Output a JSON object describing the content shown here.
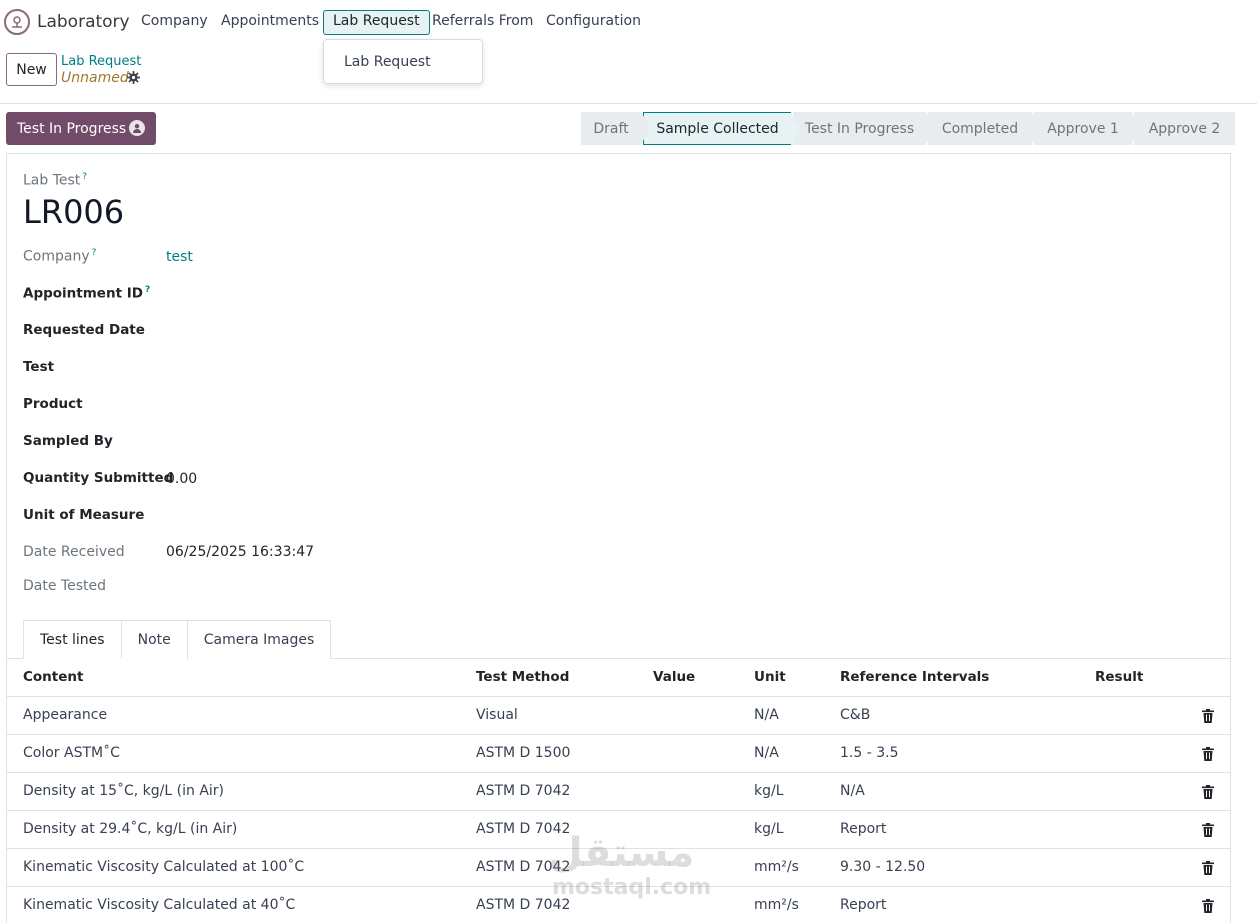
{
  "app": {
    "name": "Laboratory",
    "logo_icon": "microscope-icon"
  },
  "nav": {
    "items": [
      {
        "label": "Company"
      },
      {
        "label": "Appointments"
      },
      {
        "label": "Lab Request"
      },
      {
        "label": "Referrals From"
      },
      {
        "label": "Configuration"
      }
    ],
    "active_index": 2,
    "dropdown": {
      "items": [
        {
          "label": "Lab Request"
        }
      ]
    }
  },
  "control": {
    "new_label": "New",
    "breadcrumb": "Lab Request",
    "record_name": "Unnamed",
    "gear_icon": "gear-icon"
  },
  "status_button": {
    "label": "Test In Progress",
    "icon": "person-icon"
  },
  "statusbar": {
    "stages": [
      {
        "label": "Draft"
      },
      {
        "label": "Sample Collected"
      },
      {
        "label": "Test In Progress"
      },
      {
        "label": "Completed"
      },
      {
        "label": "Approve 1"
      },
      {
        "label": "Approve 2"
      }
    ],
    "current_index": 1
  },
  "form": {
    "lab_test_label": "Lab Test",
    "help_mark": "?",
    "title": "LR006",
    "fields": [
      {
        "label": "Company",
        "value": "test",
        "help": true
      },
      {
        "label": "Appointment ID",
        "value": "",
        "help": true
      },
      {
        "label": "Requested Date",
        "value": ""
      },
      {
        "label": "Test",
        "value": ""
      },
      {
        "label": "Product",
        "value": ""
      },
      {
        "label": "Sampled By",
        "value": ""
      },
      {
        "label": "Quantity Submitted",
        "value": "0.00"
      },
      {
        "label": "Unit of Measure",
        "value": ""
      },
      {
        "label": "Date Received",
        "value": "06/25/2025 16:33:47"
      },
      {
        "label": "Date Tested",
        "value": ""
      }
    ]
  },
  "tabs": [
    {
      "label": "Test lines"
    },
    {
      "label": "Note"
    },
    {
      "label": "Camera Images"
    }
  ],
  "table": {
    "columns": [
      "Content",
      "Test Method",
      "Value",
      "Unit",
      "Reference Intervals",
      "Result"
    ],
    "rows": [
      {
        "content": "Appearance",
        "method": "Visual",
        "value": "",
        "unit": "N/A",
        "ref": "C&B",
        "result": ""
      },
      {
        "content": "Color ASTM˚C",
        "method": "ASTM D 1500",
        "value": "",
        "unit": "N/A",
        "ref": "1.5 - 3.5",
        "result": ""
      },
      {
        "content": "Density at 15˚C, kg/L (in Air)",
        "method": "ASTM D 7042",
        "value": "",
        "unit": "kg/L",
        "ref": "N/A",
        "result": ""
      },
      {
        "content": "Density at 29.4˚C, kg/L (in Air)",
        "method": "ASTM D 7042",
        "value": "",
        "unit": "kg/L",
        "ref": "Report",
        "result": ""
      },
      {
        "content": "Kinematic Viscosity Calculated at 100˚C",
        "method": "ASTM D 7042",
        "value": "",
        "unit": "mm²/s",
        "ref": "9.30 - 12.50",
        "result": ""
      },
      {
        "content": "Kinematic Viscosity Calculated at 40˚C",
        "method": "ASTM D 7042",
        "value": "",
        "unit": "mm²/s",
        "ref": "Report",
        "result": ""
      }
    ],
    "row_action_icon": "trash-icon"
  },
  "watermark": {
    "arabic": "مستقل",
    "latin": "mostaql.com"
  }
}
